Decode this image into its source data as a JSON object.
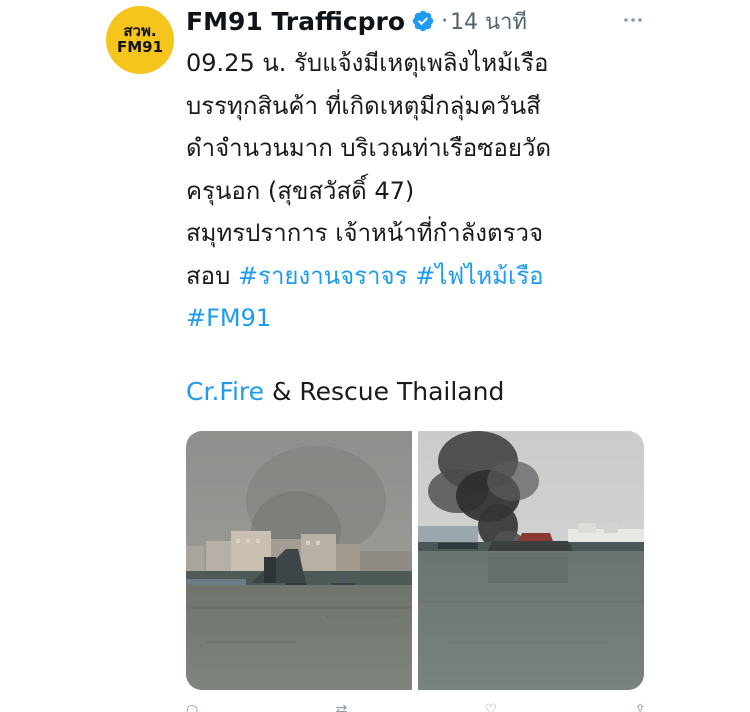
{
  "account": {
    "avatar_line1": "สวพ.",
    "avatar_line2": "FM91",
    "name": "FM91 Trafficpro",
    "dot": "·",
    "time": "14 นาที",
    "verified_icon": "verified-badge-icon",
    "more_icon": "more-options-icon"
  },
  "tweet": {
    "lines": [
      "09.25 น. รับแจ้งมีเหตุเพลิงไหม้เรือ",
      "บรรทุกสินค้า ที่เกิดเหตุมีกลุ่มควันสี",
      "ดำจำนวนมาก บริเวณท่าเรือซอยวัด",
      "ครุนอก (สุขสวัสดิ์ 47)",
      "สมุทรปราการ เจ้าหน้าที่กำลังตรวจ"
    ],
    "line6_prefix": "สอบ ",
    "hashtag1": "#รายงานจราจร",
    "hashtag2": "#ไฟไหม้เรือ",
    "hashtag3": "#FM91",
    "credit_link": "Cr.Fire",
    "credit_rest": " & Rescue Thailand"
  },
  "media": {
    "photo1": "river-harbor-hazy-photo",
    "photo2": "ship-fire-smoke-photo"
  },
  "colors": {
    "link": "#1d9bf0",
    "avatar_bg": "#f5c51d",
    "text": "#1a1a1a",
    "muted": "#536471"
  }
}
